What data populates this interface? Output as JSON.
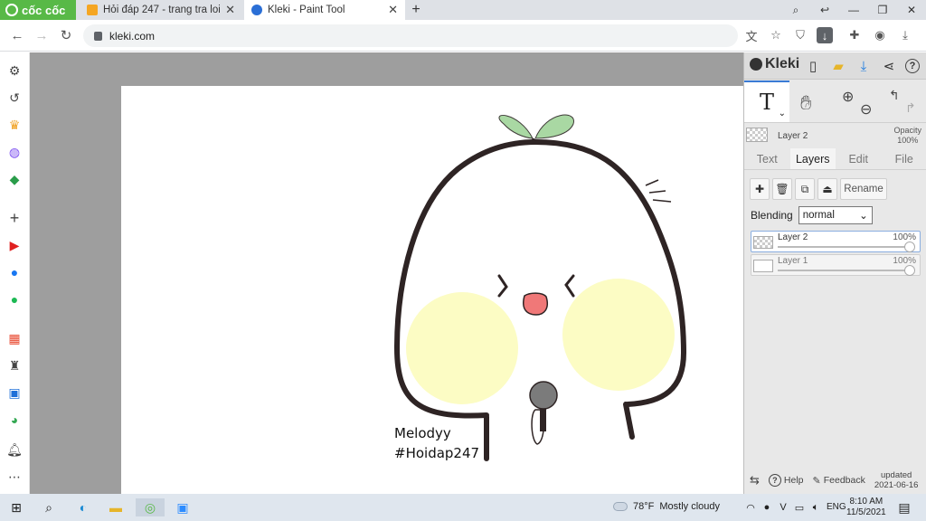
{
  "browser": {
    "brand": "cốc cốc",
    "tabs": [
      {
        "title": "Hỏi đáp 247 - trang tra loi",
        "icon": "hoidap-favicon",
        "active": false
      },
      {
        "title": "Kleki - Paint Tool",
        "icon": "kleki-favicon",
        "active": true
      }
    ],
    "new_tab": "+",
    "window_controls": {
      "minimize": "—",
      "restore": "❐",
      "close": "✕"
    },
    "address": "kleki.com"
  },
  "sidebar_icons": [
    "settings-icon",
    "history-icon",
    "crown-icon",
    "messenger-icon",
    "game-icon",
    "add-icon",
    "youtube-icon",
    "facebook-icon",
    "spotify-icon",
    "shop-icon",
    "rocket-icon",
    "sale-1111-icon",
    "maps-icon",
    "bell-icon",
    "more-icon"
  ],
  "canvas": {
    "signature_line1": "Melodyy",
    "signature_line2": "#Hoidap247"
  },
  "panel": {
    "logo": "Kleki",
    "current_layer": "Layer 2",
    "opacity_label": "Opacity",
    "opacity_value": "100%",
    "tabs": [
      "Text",
      "Layers",
      "Edit",
      "File"
    ],
    "active_tab": "Layers",
    "rename_label": "Rename",
    "blending_label": "Blending",
    "blending_value": "normal",
    "layers": [
      {
        "name": "Layer 2",
        "opacity": "100%",
        "opacity_fraction": 1.0,
        "active": true
      },
      {
        "name": "Layer 1",
        "opacity": "100%",
        "opacity_fraction": 1.0,
        "active": false
      }
    ],
    "help_label": "Help",
    "feedback_label": "Feedback",
    "updated_label": "updated",
    "updated_date": "2021-06-16"
  },
  "taskbar": {
    "weather_temp": "78°F",
    "weather_text": "Mostly cloudy",
    "language": "ENG",
    "time": "8:10 AM",
    "date": "11/5/2021"
  },
  "colors": {
    "brand_green": "#58b947",
    "outline": "#2e2424",
    "cheek": "#fcfcc4",
    "leaf": "#a9d8a3",
    "mouth": "#f07878",
    "accent_blue": "#3a7bd5"
  }
}
